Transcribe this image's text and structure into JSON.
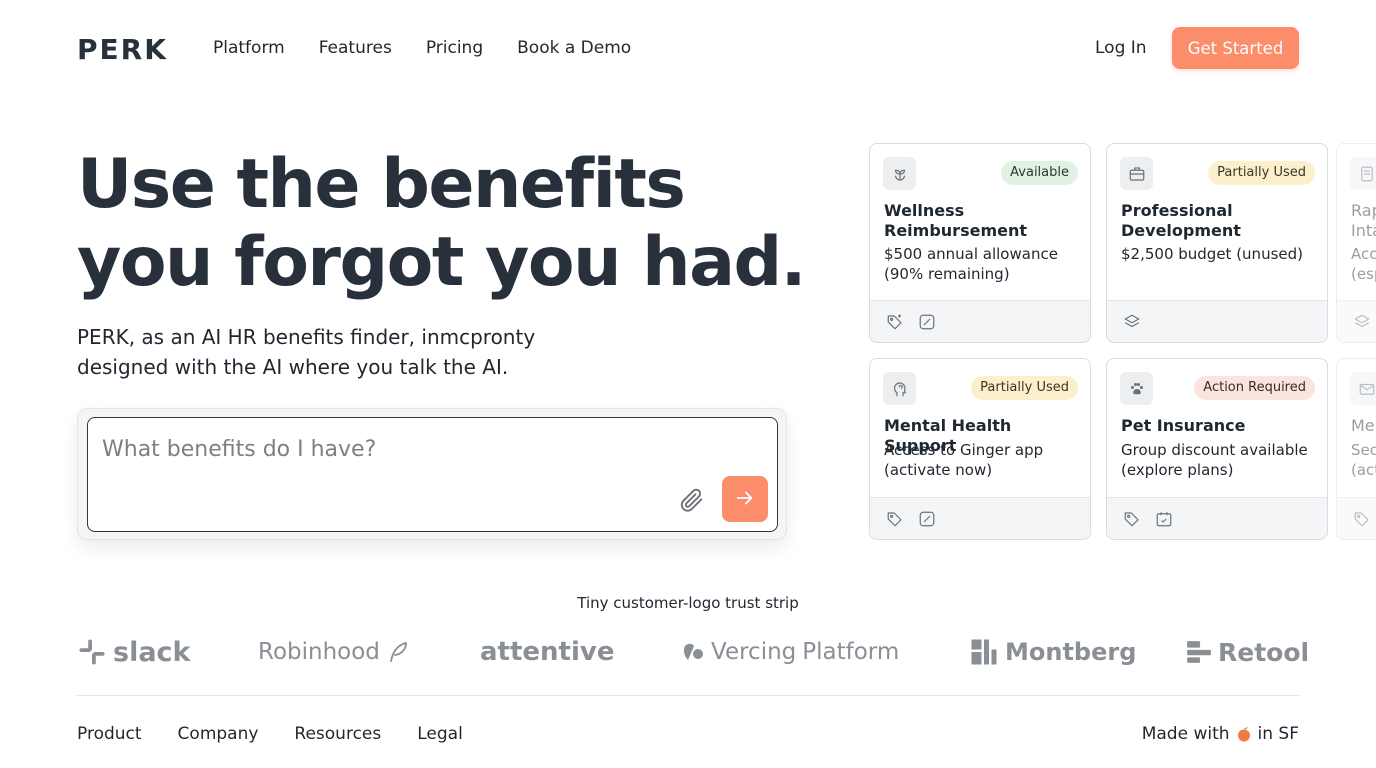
{
  "nav": {
    "brand": "PERK",
    "links": [
      "Platform",
      "Features",
      "Pricing",
      "Book a Demo"
    ],
    "login": "Log In",
    "cta": "Get Started"
  },
  "hero": {
    "title_line1": "Use the benefits",
    "title_line2": "you forgot you had.",
    "subtitle": "PERK, as an AI HR benefits finder, inmcpronty designed with the AI where you talk the AI.",
    "search_placeholder": "What benefits do I have?"
  },
  "cards": [
    {
      "title": "Wellness Reimbursement",
      "desc": "$500 annual allowance (90% remaining)",
      "status": "Available",
      "icon": "sprout-icon"
    },
    {
      "title": "Professional Development",
      "desc": "$2,500 budget (unused)",
      "status": "Partially Used",
      "icon": "briefcase-icon"
    },
    {
      "title": "Rap Inta",
      "desc": "Acc (esp",
      "icon": "document-icon"
    },
    {
      "title": "Mental Health Support",
      "desc": "Access to Ginger app (activate now)",
      "status": "Partially Used",
      "icon": "head-icon"
    },
    {
      "title": "Pet Insurance",
      "desc": "Group discount available (explore plans)",
      "status": "Action Required",
      "icon": "paw-icon"
    },
    {
      "title": "Men",
      "desc": "Sec (act",
      "icon": "mail-icon"
    }
  ],
  "trust": {
    "label": "Tiny customer-logo trust strip",
    "logos": [
      "slack",
      "Robinhood",
      "attentive",
      "Vercing",
      "Platform",
      "Montberg",
      "Retool"
    ]
  },
  "footer": {
    "links": [
      "Product",
      "Company",
      "Resources",
      "Legal"
    ],
    "made_prefix": "Made with",
    "made_suffix": "in SF"
  },
  "colors": {
    "accent": "#fb8d6a",
    "text": "#1f2730",
    "available_bg": "#dff2e4",
    "partial_bg": "#fbefcc",
    "action_bg": "#fbe3df"
  }
}
